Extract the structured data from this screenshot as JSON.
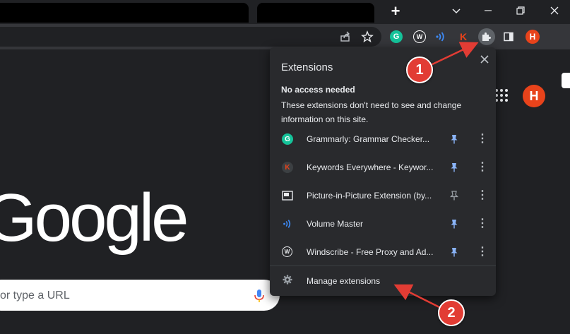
{
  "browser": {
    "new_tab_label": "+",
    "profile_initial": "H",
    "toolbar_extensions": [
      {
        "name": "Grammarly",
        "glyph": "G",
        "color": "#15c39a"
      },
      {
        "name": "Windscribe",
        "glyph": "W",
        "color": "#ffffff"
      },
      {
        "name": "Volume Master",
        "glyph": ")))",
        "color": "#3d8af7"
      },
      {
        "name": "Keywords Everywhere",
        "glyph": "K",
        "color": "#e8431b"
      }
    ]
  },
  "page": {
    "logo_text": "Google",
    "search_placeholder": "or type a URL",
    "account_initial": "H"
  },
  "extensions_menu": {
    "title": "Extensions",
    "section_heading": "No access needed",
    "section_description": "These extensions don't need to see and change information on this site.",
    "items": [
      {
        "name": "Grammarly: Grammar Checker...",
        "icon": "grammarly-icon",
        "pinned": true
      },
      {
        "name": "Keywords Everywhere - Keywor...",
        "icon": "keywords-everywhere-icon",
        "pinned": true
      },
      {
        "name": "Picture-in-Picture Extension (by...",
        "icon": "picture-in-picture-icon",
        "pinned": false
      },
      {
        "name": "Volume Master",
        "icon": "volume-master-icon",
        "pinned": true
      },
      {
        "name": "Windscribe - Free Proxy and Ad...",
        "icon": "windscribe-icon",
        "pinned": true
      }
    ],
    "manage_label": "Manage extensions"
  },
  "annotations": [
    {
      "label": "1"
    },
    {
      "label": "2"
    }
  ],
  "colors": {
    "pinned": "#8ab4f8",
    "unpinned": "#9aa0a6",
    "callout": "#e23c34"
  }
}
